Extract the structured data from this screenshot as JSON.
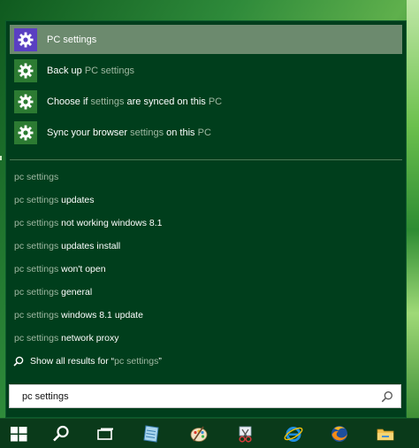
{
  "apps": [
    {
      "label": "PC settings",
      "parts": [
        {
          "t": "PC settings",
          "dim": false
        }
      ],
      "selected": true,
      "tile_color": "#5a3fc2"
    },
    {
      "label": "Back up PC settings",
      "parts": [
        {
          "t": "Back up ",
          "dim": false
        },
        {
          "t": "PC settings",
          "dim": true
        }
      ],
      "selected": false,
      "tile_color": "#2c7b32"
    },
    {
      "label": "Choose if settings are synced on this PC",
      "parts": [
        {
          "t": "Choose if ",
          "dim": false
        },
        {
          "t": "settings",
          "dim": true
        },
        {
          "t": " are synced on this ",
          "dim": false
        },
        {
          "t": "PC",
          "dim": true
        }
      ],
      "selected": false,
      "tile_color": "#2c7b32"
    },
    {
      "label": "Sync your browser settings on this PC",
      "parts": [
        {
          "t": "Sync your browser ",
          "dim": false
        },
        {
          "t": "settings",
          "dim": true
        },
        {
          "t": " on this ",
          "dim": false
        },
        {
          "t": "PC",
          "dim": true
        }
      ],
      "selected": false,
      "tile_color": "#2c7b32"
    }
  ],
  "suggestions": [
    {
      "query": "pc settings",
      "suffix": ""
    },
    {
      "query": "pc settings",
      "suffix": " updates"
    },
    {
      "query": "pc settings",
      "suffix": " not working windows 8.1"
    },
    {
      "query": "pc settings",
      "suffix": " updates install"
    },
    {
      "query": "pc settings",
      "suffix": " won't open"
    },
    {
      "query": "pc settings",
      "suffix": " general"
    },
    {
      "query": "pc settings",
      "suffix": " windows 8.1 update"
    },
    {
      "query": "pc settings",
      "suffix": " network proxy"
    }
  ],
  "show_all": {
    "prefix": "Show all results for “",
    "query": "pc settings",
    "suffix": "”"
  },
  "search": {
    "value": "pc settings",
    "icon": "search-icon"
  },
  "taskbar": [
    {
      "name": "start-button",
      "icon": "windows-logo-icon"
    },
    {
      "name": "taskbar-search-button",
      "icon": "search-icon"
    },
    {
      "name": "task-view-button",
      "icon": "task-view-icon"
    },
    {
      "name": "taskbar-app-notepad",
      "icon": "notepad-icon"
    },
    {
      "name": "taskbar-app-paint",
      "icon": "paint-palette-icon"
    },
    {
      "name": "taskbar-app-snipping",
      "icon": "scissors-icon"
    },
    {
      "name": "taskbar-app-ie",
      "icon": "internet-explorer-icon"
    },
    {
      "name": "taskbar-app-firefox",
      "icon": "firefox-icon"
    },
    {
      "name": "taskbar-app-explorer",
      "icon": "folder-icon"
    }
  ],
  "colors": {
    "panel": "#003e1c",
    "selected_row": "#6c8a6e",
    "dim_text": "#9fb8a2",
    "accent_purple": "#5a3fc2",
    "tile_green": "#2c7b32"
  }
}
